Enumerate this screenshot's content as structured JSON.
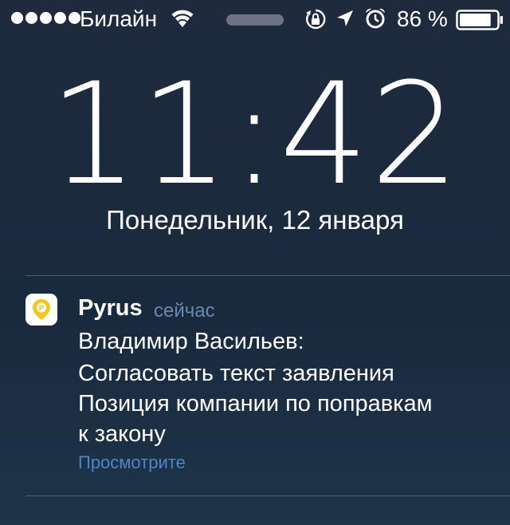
{
  "status_bar": {
    "carrier": "Билайн",
    "battery_percent": "86 %",
    "battery_level": 0.86,
    "signal_bars": 5,
    "icons": [
      "wifi-icon",
      "rotation-lock-icon",
      "location-arrow-icon",
      "alarm-icon",
      "battery-icon"
    ]
  },
  "lock_screen": {
    "time": "11:42",
    "date": "Понедельник, 12 января"
  },
  "notification": {
    "app_name": "Pyrus",
    "time_ago": "сейчас",
    "icon": "pyrus-app-icon",
    "lines": [
      "Владимир Васильев:",
      "Согласовать текст заявления",
      "Позиция компании по поправкам",
      "к закону"
    ],
    "action": "Просмотрите"
  },
  "colors": {
    "background": "#1c2a3e",
    "accent_link": "#4f85c3",
    "secondary_text": "#6c88ad",
    "app_icon_yellow": "#f5c518"
  }
}
